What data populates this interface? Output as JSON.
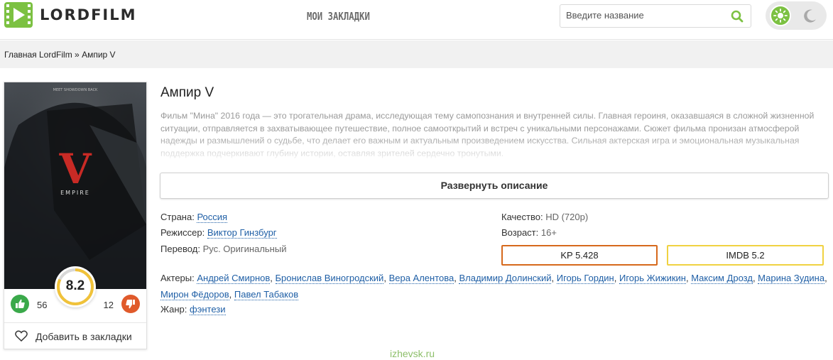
{
  "header": {
    "logo_text": "LORDFILM",
    "bookmarks_label": "МОИ ЗАКЛАДКИ",
    "search_placeholder": "Введите название"
  },
  "breadcrumb": {
    "home": "Главная LordFilm",
    "separator": "»",
    "current": "Ампир V"
  },
  "poster": {
    "top_text": "MEET SHOWDOWN BACK",
    "letter": "V",
    "caption": "EMPIRE"
  },
  "rating": {
    "score": "8.2",
    "score_fraction": 0.82,
    "likes": "56",
    "dislikes": "12"
  },
  "favorite": {
    "label": "Добавить в закладки"
  },
  "movie": {
    "title": "Ампир V",
    "description": "Фильм \"Мина\" 2016 года — это трогательная драма, исследующая тему самопознания и внутренней силы. Главная героиня, оказавшаяся в сложной жизненной ситуации, отправляется в захватывающее путешествие, полное самооткрытий и встреч с уникальными персонажами. Сюжет фильма пронизан атмосферой надежды и размышлений о судьбе, что делает его важным и актуальным произведением искусства. Сильная актерская игра и эмоциональная музыкальная поддержка подчеркивают глубину истории, оставляя зрителей сердечно тронутыми.",
    "expand_label": "Развернуть описание",
    "country_label": "Страна:",
    "country": "Россия",
    "director_label": "Режиссер:",
    "director": "Виктор Гинзбург",
    "translation_label": "Перевод:",
    "translation": "Рус. Оригинальный",
    "quality_label": "Качество:",
    "quality": "HD (720p)",
    "age_label": "Возраст:",
    "age": "16+",
    "kp": "KP 5.428",
    "imdb": "IMDB 5.2",
    "actors_label": "Актеры:",
    "actors": [
      "Андрей Смирнов",
      "Бронислав Виногродский",
      "Вера Алентова",
      "Владимир Долинский",
      "Игорь Гордин",
      "Игорь Жижикин",
      "Максим Дрозд",
      "Марина Зудина",
      "Мирон Фёдоров",
      "Павел Табаков"
    ],
    "genre_label": "Жанр:",
    "genre": "фэнтези"
  },
  "watermark": "izhevsk.ru",
  "colors": {
    "accent_green": "#7cc142",
    "like_green": "#3aa94a",
    "dislike_orange": "#e05a2b",
    "kp_border": "#d6691c",
    "imdb_border": "#f0d241",
    "link_blue": "#1f5fa6",
    "score_ring": "#f0c23a"
  }
}
